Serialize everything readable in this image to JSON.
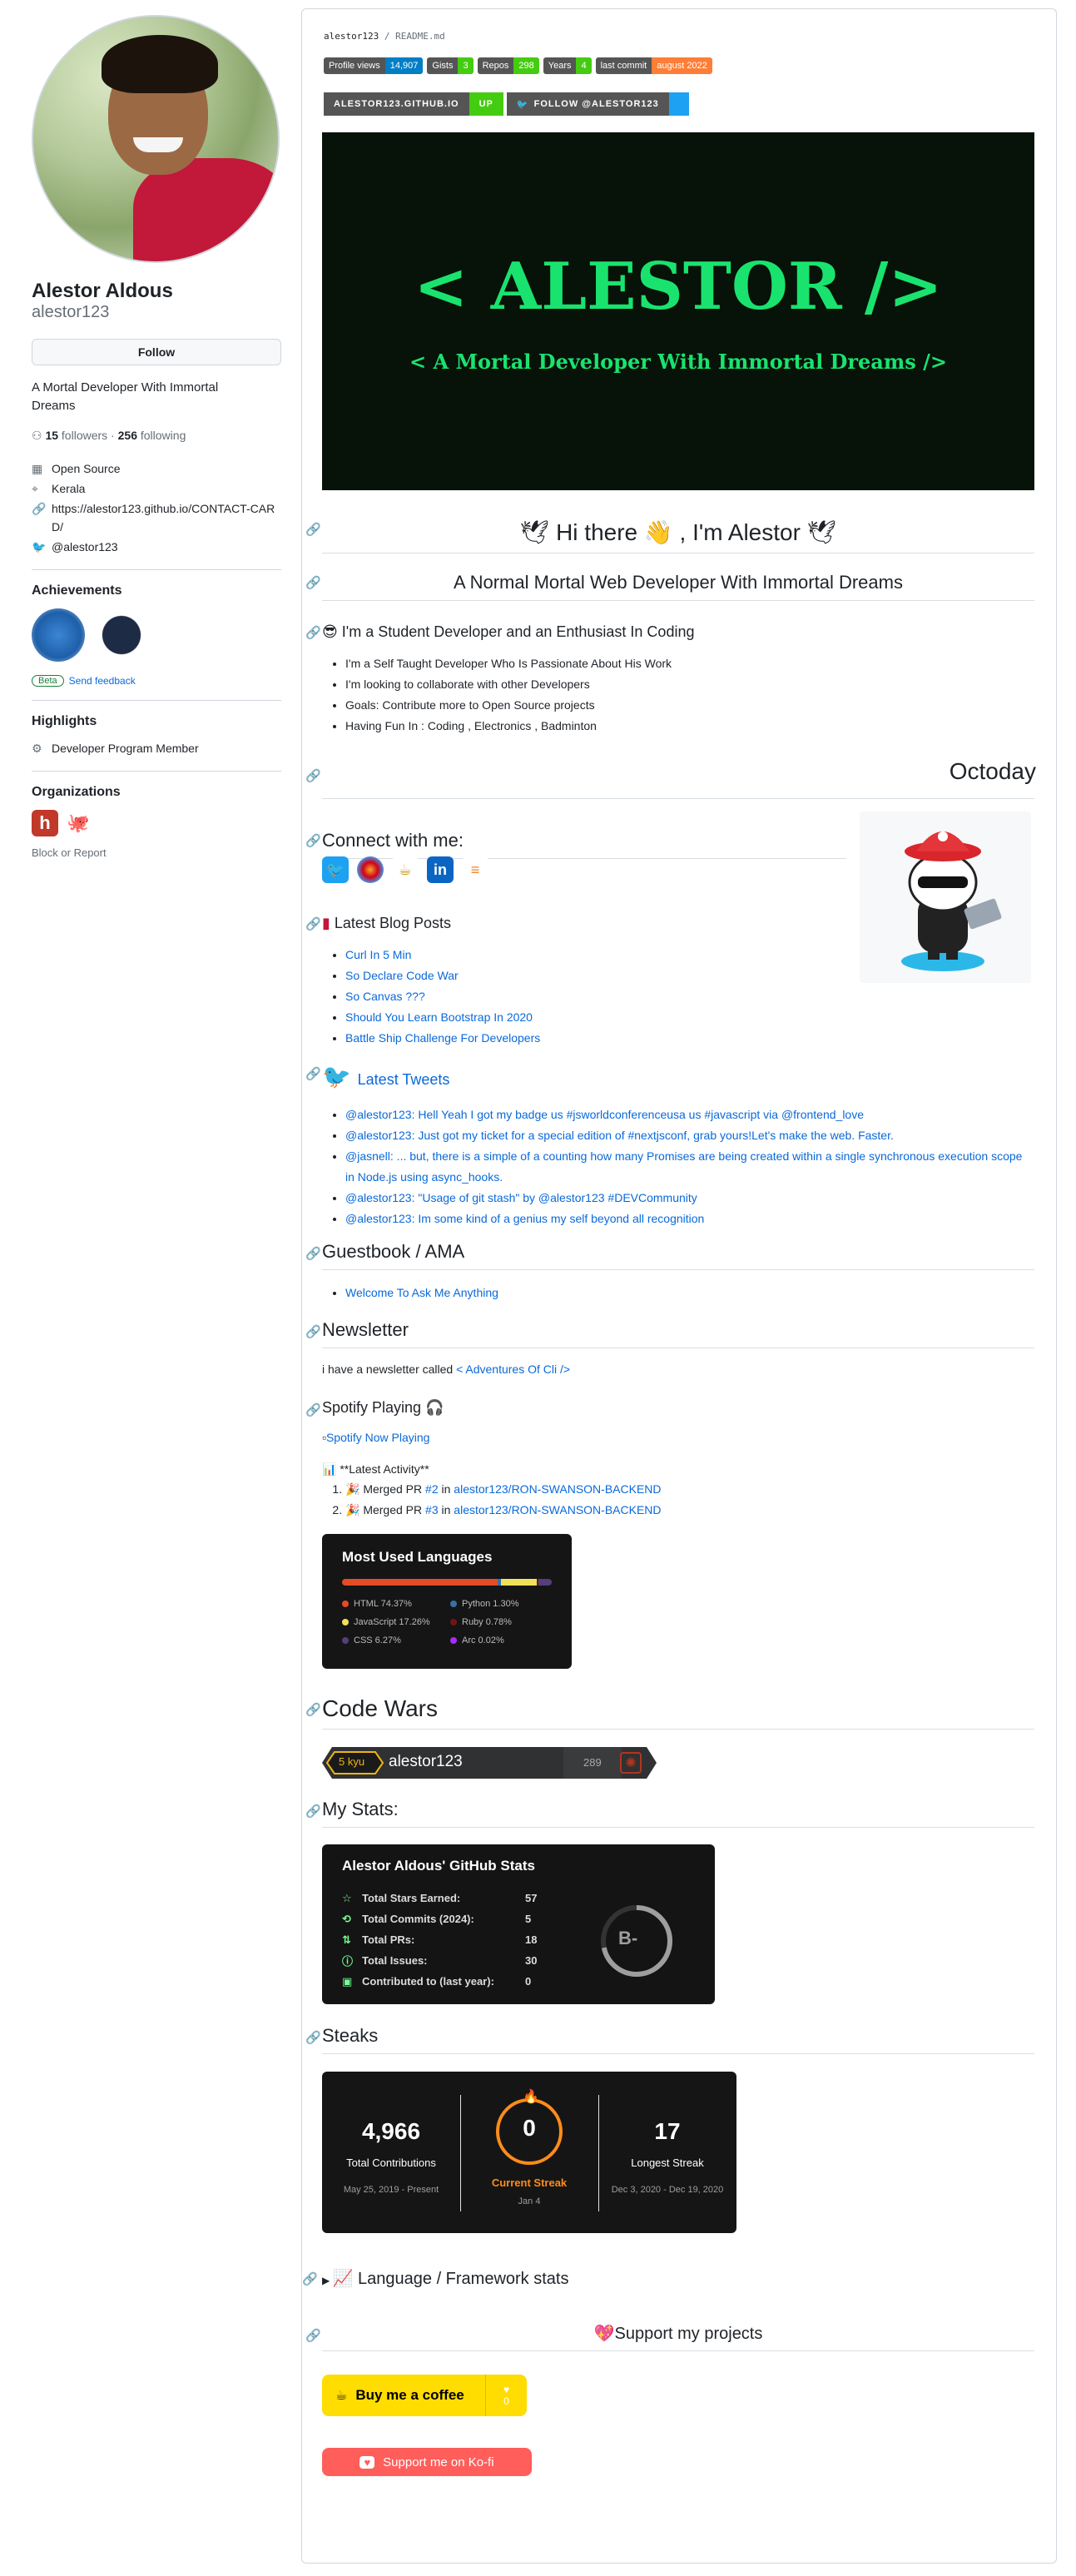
{
  "profile": {
    "name": "Alestor Aldous",
    "login": "alestor123",
    "follow_label": "Follow",
    "bio": "A Mortal Developer With Immortal Dreams",
    "followers_count": "15",
    "followers_label": "followers",
    "following_count": "256",
    "following_label": "following",
    "details": [
      {
        "icon": "organization-icon",
        "text": "Open Source"
      },
      {
        "icon": "location-icon",
        "text": "Kerala"
      },
      {
        "icon": "link-icon",
        "text": "https://alestor123.github.io/CONTACT-CARD/"
      },
      {
        "icon": "twitter-icon",
        "text": "@alestor123"
      }
    ],
    "achievements_title": "Achievements",
    "beta_label": "Beta",
    "feedback_label": "Send feedback",
    "highlights_title": "Highlights",
    "highlight_item": "Developer Program Member",
    "organizations_title": "Organizations",
    "block_label": "Block or Report"
  },
  "readme": {
    "path_user": "alestor123",
    "path_sep": " / ",
    "path_file": "README.md",
    "shields": [
      {
        "label": "Profile views",
        "value": "14,907",
        "color": "#007ec6"
      },
      {
        "label": "Gists",
        "value": "3",
        "color": "#4c1"
      },
      {
        "label": "Repos",
        "value": "298",
        "color": "#4c1"
      },
      {
        "label": "Years",
        "value": "4",
        "color": "#4c1"
      },
      {
        "label": "last commit",
        "value": "august 2022",
        "color": "#fe7d37"
      }
    ],
    "site_label": "ALESTOR123.GITHUB.IO",
    "site_status": "UP",
    "twitter_follow": "FOLLOW @ALESTOR123",
    "hero_title": "< ALESTOR />",
    "hero_subtitle": "< A Mortal Developer With Immortal Dreams />",
    "greeting": "Hi there 👋 , I'm Alestor",
    "tagline": "A Normal Mortal Web Developer With Immortal Dreams",
    "intro_heading": "I'm a Student Developer and an Enthusiast In Coding",
    "intro_items": [
      "I'm a Self Taught Developer Who Is Passionate About His Work",
      "I'm looking to collaborate with other Developers",
      "Goals: Contribute more to Open Source projects",
      "Having Fun In : Coding , Electronics , Badminton"
    ],
    "octoday": "Octoday",
    "connect_heading": "Connect with me:",
    "blog_heading": "Latest Blog Posts",
    "blog_posts": [
      "Curl In 5 Min",
      "So Declare Code War",
      "So Canvas ???",
      "Should You Learn Bootstrap In 2020",
      "Battle Ship Challenge For Developers"
    ],
    "tweets_heading": "Latest Tweets",
    "tweets": [
      "@alestor123: Hell Yeah I got my badge us #jsworldconferenceusa us #javascript via @frontend_love",
      "@alestor123: Just got my ticket for a special edition of #nextjsconf, grab yours!Let's make the web. Faster.",
      "@jasnell: ... but, there is a simple of a counting how many Promises are being created within a single synchronous execution scope in Node.js using async_hooks.",
      "@alestor123: \"Usage of git stash\" by @alestor123 #DEVCommunity",
      "@alestor123: Im some kind of a genius my self beyond all recognition"
    ],
    "guestbook_heading": "Guestbook / AMA",
    "guestbook_link": "Welcome To Ask Me Anything",
    "newsletter_heading": "Newsletter",
    "newsletter_text": "i have a newsletter called ",
    "newsletter_link": "< Adventures Of Cli />",
    "spotify_heading": "Spotify Playing 🎧",
    "spotify_alt": "Spotify Now Playing",
    "activity_heading": "📊 **Latest Activity**",
    "activity": [
      {
        "text": "🎉 Merged PR ",
        "pr": "#2",
        "in": " in ",
        "repo": "alestor123/RON-SWANSON-BACKEND"
      },
      {
        "text": "🎉 Merged PR ",
        "pr": "#3",
        "in": " in ",
        "repo": "alestor123/RON-SWANSON-BACKEND"
      }
    ],
    "lang_card": {
      "title": "Most Used Languages",
      "langs": [
        {
          "name": "HTML 74.37%",
          "pct": 74.37,
          "color": "#e34c26"
        },
        {
          "name": "Python 1.30%",
          "pct": 1.3,
          "color": "#3572A5"
        },
        {
          "name": "JavaScript 17.26%",
          "pct": 17.26,
          "color": "#f1e05a"
        },
        {
          "name": "Ruby 0.78%",
          "pct": 0.78,
          "color": "#701516"
        },
        {
          "name": "CSS 6.27%",
          "pct": 6.27,
          "color": "#563d7c"
        },
        {
          "name": "Arc 0.02%",
          "pct": 0.02,
          "color": "#aa2afe"
        }
      ]
    },
    "codewars_heading": "Code Wars",
    "codewars_rank": "5 kyu",
    "codewars_user": "alestor123",
    "codewars_score": "289",
    "stats_heading": "My Stats:",
    "stats_card": {
      "title": "Alestor Aldous' GitHub Stats",
      "rows": [
        {
          "label": "Total Stars Earned:",
          "value": "57"
        },
        {
          "label": "Total Commits (2024):",
          "value": "5"
        },
        {
          "label": "Total PRs:",
          "value": "18"
        },
        {
          "label": "Total Issues:",
          "value": "30"
        },
        {
          "label": "Contributed to (last year):",
          "value": "0"
        }
      ],
      "grade": "B-"
    },
    "steaks_heading": "Steaks",
    "streak_card": {
      "total": "4,966",
      "total_label": "Total Contributions",
      "total_range": "May 25, 2019 - Present",
      "current": "0",
      "current_label": "Current Streak",
      "current_date": "Jan 4",
      "longest": "17",
      "longest_label": "Longest Streak",
      "longest_range": "Dec 3, 2020 - Dec 19, 2020"
    },
    "lang_stats_heading": "📈 Language / Framework stats",
    "support_heading": "Support my projects",
    "coffee_label": "Buy me a coffee",
    "coffee_count": "0",
    "kofi_label": "Support me on Ko-fi"
  },
  "colors": {
    "accent": "#0969da",
    "hero_green": "#19e36e",
    "orange": "#fe8c1a"
  }
}
